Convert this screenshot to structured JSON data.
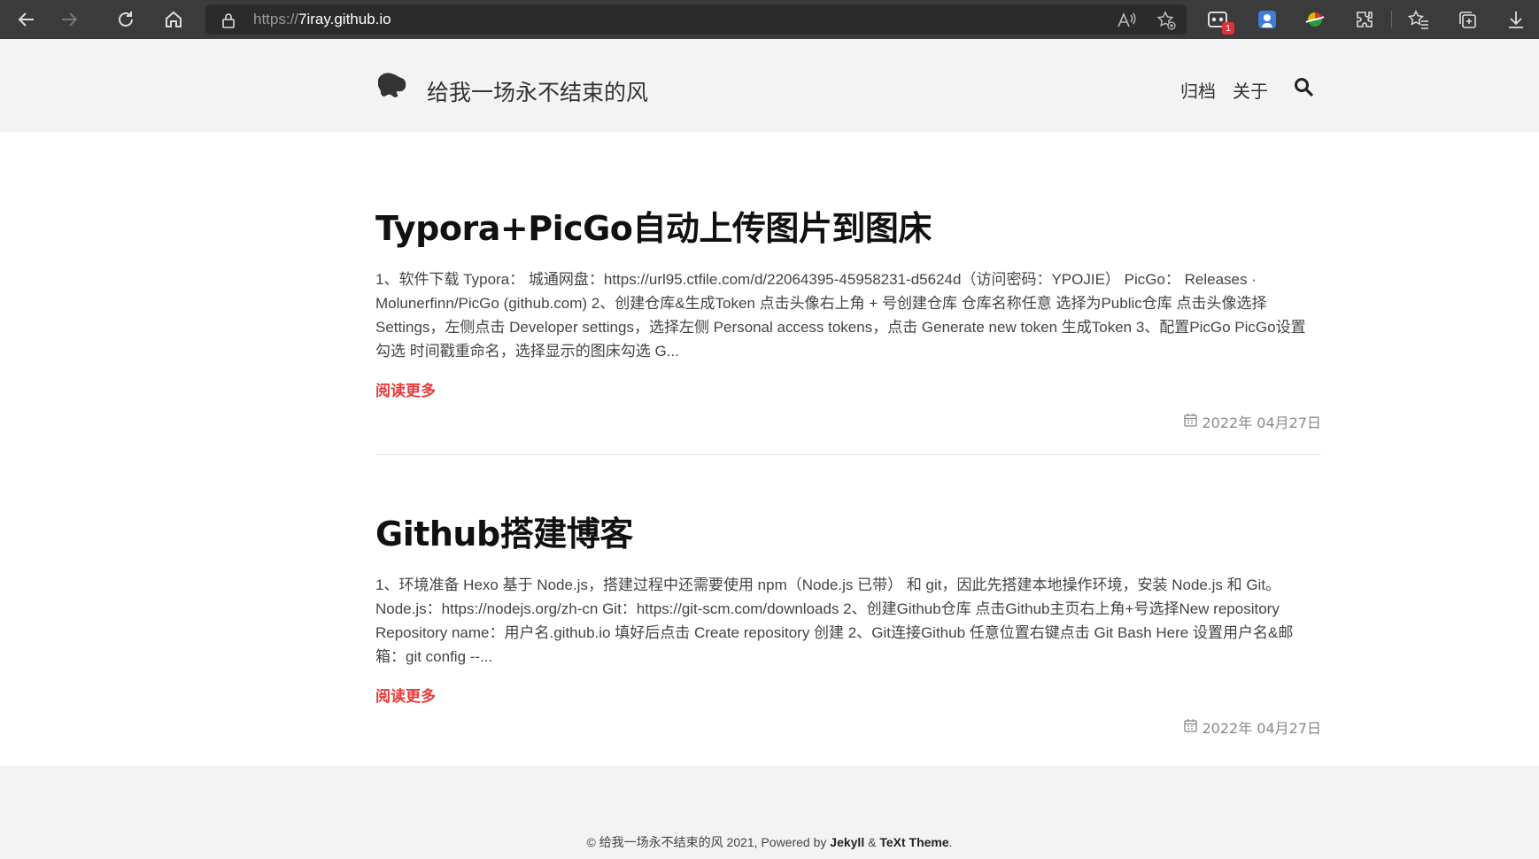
{
  "browser": {
    "url_scheme": "https://",
    "url_host": "7iray.github.io",
    "extension_badge": "1",
    "icons": [
      "back-icon",
      "forward-icon",
      "refresh-icon",
      "home-icon",
      "lock-icon",
      "read-aloud-icon",
      "add-favorite-icon",
      "extension-icon",
      "profile-extension-icon",
      "color-extension-icon",
      "extensions-icon",
      "favorites-icon",
      "collections-icon",
      "downloads-icon"
    ]
  },
  "site": {
    "title": "给我一场永不结束的风",
    "nav": [
      {
        "label": "归档"
      },
      {
        "label": "关于"
      }
    ]
  },
  "posts": [
    {
      "title": "Typora+PicGo自动上传图片到图床",
      "excerpt": "1、软件下载 Typora： 城通网盘：https://url95.ctfile.com/d/22064395-45958231-d5624d（访问密码：YPOJIE） PicGo： Releases · Molunerfinn/PicGo (github.com) 2、创建仓库&生成Token 点击头像右上角 + 号创建仓库 仓库名称任意 选择为Public仓库 点击头像选择 Settings，左侧点击 Developer settings，选择左侧 Personal access tokens，点击 Generate new token 生成Token 3、配置PicGo PicGo设置 勾选 时间戳重命名，选择显示的图床勾选 G...",
      "read_more": "阅读更多",
      "date": "2022年 04月27日"
    },
    {
      "title": "Github搭建博客",
      "excerpt": "1、环境准备 Hexo 基于 Node.js，搭建过程中还需要使用 npm（Node.js 已带） 和 git，因此先搭建本地操作环境，安装 Node.js 和 Git。 Node.js：https://nodejs.org/zh-cn Git：https://git-scm.com/downloads 2、创建Github仓库 点击Github主页右上角+号选择New repository Repository name：用户名.github.io 填好后点击 Create repository 创建 2、Git连接Github 任意位置右键点击 Git Bash Here 设置用户名&邮箱：git config --...",
      "read_more": "阅读更多",
      "date": "2022年 04月27日"
    }
  ],
  "footer": {
    "prefix": "© 给我一场永不结束的风 2021, Powered by ",
    "jekyll": "Jekyll",
    "amp": " & ",
    "theme": "TeXt Theme",
    "suffix": "."
  },
  "colors": {
    "accent": "#e63c3c",
    "chrome_bg": "#3b3b3b",
    "page_bg": "#f3f3f3"
  }
}
